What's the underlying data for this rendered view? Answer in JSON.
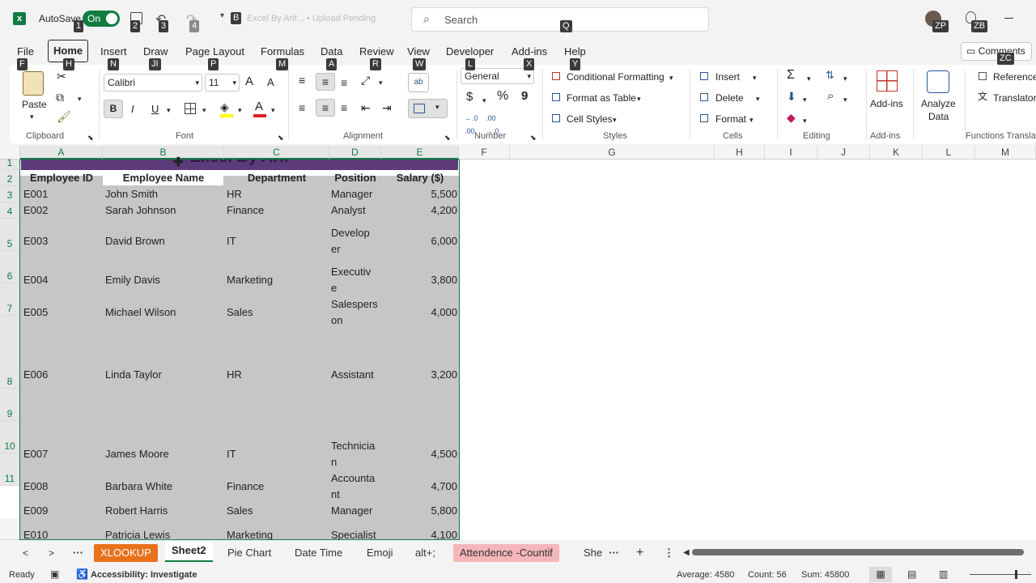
{
  "titlebar": {
    "autosave_label": "AutoSave",
    "toggle_label": "On",
    "file_name": "Excel By Arif... • Upload Pending",
    "search_placeholder": "Search",
    "keytips": {
      "k1": "1",
      "k2": "2",
      "k3": "3",
      "k4": "4",
      "kB": "B",
      "kQ": "Q",
      "kZP": "ZP",
      "kZB": "ZB"
    }
  },
  "menu": {
    "items": [
      {
        "label": "File",
        "key": "F"
      },
      {
        "label": "Home",
        "key": "H"
      },
      {
        "label": "Insert",
        "key": "N"
      },
      {
        "label": "Draw",
        "key": "JI"
      },
      {
        "label": "Page Layout",
        "key": "P"
      },
      {
        "label": "Formulas",
        "key": "M"
      },
      {
        "label": "Data",
        "key": "A"
      },
      {
        "label": "Review",
        "key": "R"
      },
      {
        "label": "View",
        "key": "W"
      },
      {
        "label": "Developer",
        "key": "L"
      },
      {
        "label": "Add-ins",
        "key": "X"
      },
      {
        "label": "Help",
        "key": "Y"
      }
    ],
    "comments_label": "Comments",
    "comments_key": "ZC"
  },
  "ribbon": {
    "clipboard": {
      "paste": "Paste",
      "group": "Clipboard"
    },
    "font": {
      "name": "Calibri",
      "size": "11",
      "bold": "B",
      "italic": "I",
      "underline": "U",
      "grow": "A",
      "shrink": "A",
      "group": "Font",
      "font_color": "#e02020",
      "highlight_color": "#ffff00"
    },
    "alignment": {
      "group": "Alignment",
      "wrap_icon": "ab"
    },
    "number": {
      "format": "General",
      "currency": "$",
      "percent": "%",
      "comma": "9",
      "group": "Number"
    },
    "styles": {
      "conditional": "Conditional Formatting",
      "table": "Format as Table",
      "cell_styles": "Cell Styles",
      "group": "Styles"
    },
    "cells": {
      "insert": "Insert",
      "delete": "Delete",
      "format": "Format",
      "group": "Cells"
    },
    "editing": {
      "group": "Editing"
    },
    "addins": {
      "label": "Add-ins",
      "group": "Add-ins"
    },
    "analyze": {
      "line1": "Analyze",
      "line2": "Data"
    },
    "functions": {
      "reference": "Reference",
      "translator": "Translator",
      "group": "Functions Transla"
    }
  },
  "grid": {
    "columns": [
      "A",
      "B",
      "C",
      "D",
      "E",
      "F",
      "G",
      "H",
      "I",
      "J",
      "K",
      "L",
      "M"
    ],
    "rows": [
      "1",
      "2",
      "3",
      "4",
      "5",
      "6",
      "7",
      "8",
      "9",
      "10",
      "11"
    ],
    "title": "Excel By Arif",
    "headers": [
      "Employee ID",
      "Employee Name",
      "Department",
      "Position",
      "Salary ($)"
    ],
    "data": [
      {
        "id": "E001",
        "name": "John Smith",
        "dept": "HR",
        "pos1": "Manager",
        "pos2": "",
        "salary": "5,500"
      },
      {
        "id": "E002",
        "name": "Sarah Johnson",
        "dept": "Finance",
        "pos1": "Analyst",
        "pos2": "",
        "salary": "4,200"
      },
      {
        "id": "E003",
        "name": "David Brown",
        "dept": "IT",
        "pos1": "Develop",
        "pos2": "er",
        "salary": "6,000"
      },
      {
        "id": "E004",
        "name": "Emily Davis",
        "dept": "Marketing",
        "pos1": "Executiv",
        "pos2": "e",
        "salary": "3,800"
      },
      {
        "id": "E005",
        "name": "Michael Wilson",
        "dept": "Sales",
        "pos1": "Salespers",
        "pos2": "on",
        "salary": "4,000"
      },
      {
        "id": "E006",
        "name": "Linda Taylor",
        "dept": "HR",
        "pos1": "Assistant",
        "pos2": "",
        "salary": "3,200"
      },
      {
        "id": "E007",
        "name": "James Moore",
        "dept": "IT",
        "pos1": "Technicia",
        "pos2": "n",
        "salary": "4,500"
      },
      {
        "id": "E008",
        "name": "Barbara White",
        "dept": "Finance",
        "pos1": "Accounta",
        "pos2": "nt",
        "salary": "4,700"
      },
      {
        "id": "E009",
        "name": "Robert Harris",
        "dept": "Sales",
        "pos1": "Manager",
        "pos2": "",
        "salary": "5,800"
      },
      {
        "id": "E010",
        "name": "Patricia Lewis",
        "dept": "Marketing",
        "pos1": "Specialist",
        "pos2": "",
        "salary": "4,100"
      }
    ]
  },
  "tabs": {
    "items": [
      "XLOOKUP",
      "Sheet2",
      "Pie Chart",
      "Date Time",
      "Emoji",
      "alt+;",
      "Attendence -Countif",
      "She"
    ],
    "more": "···"
  },
  "status": {
    "ready": "Ready",
    "accessibility": "Accessibility: Investigate",
    "average": "Average: 4580",
    "count": "Count: 56",
    "sum": "Sum: 45800"
  },
  "colors": {
    "excel_green": "#107c41",
    "selection_gray": "#c6c6c6",
    "title_purple": "#5c3b7a",
    "tab_orange": "#e8711a",
    "tab_pink": "#f4b6b9"
  }
}
